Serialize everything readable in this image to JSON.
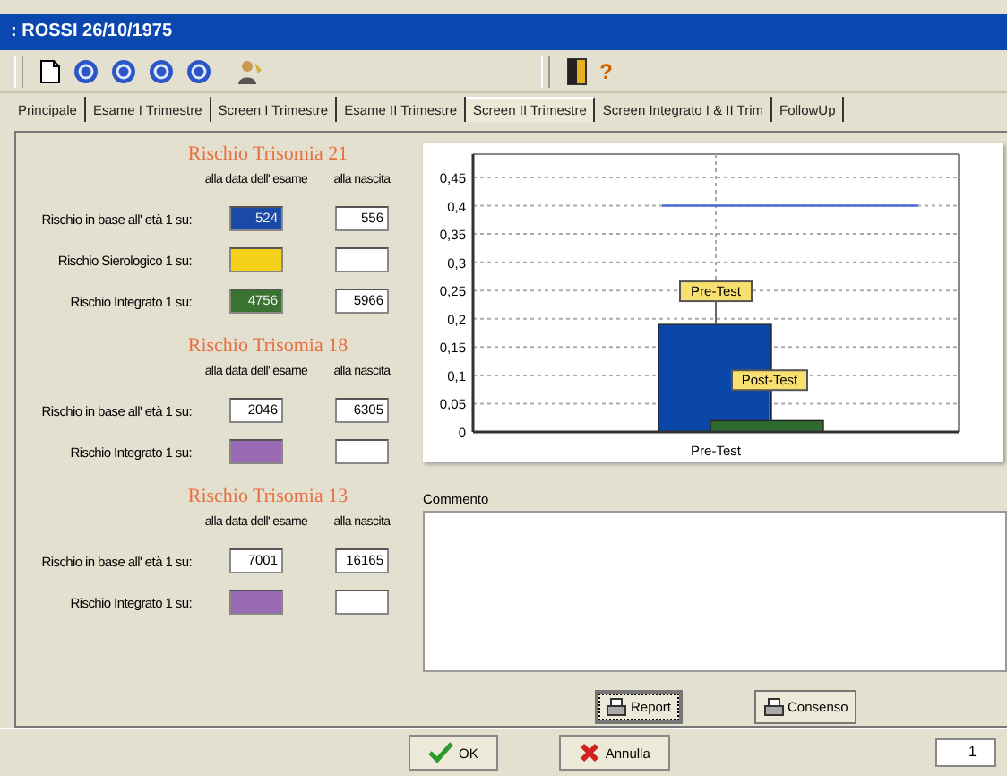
{
  "window": {
    "title": ": ROSSI 26/10/1975"
  },
  "toolbar": [
    {
      "kind": "document"
    },
    {
      "kind": "nav"
    },
    {
      "kind": "nav"
    },
    {
      "kind": "nav"
    },
    {
      "kind": "nav"
    },
    {
      "kind": "person"
    },
    {
      "kind": "door"
    },
    {
      "kind": "help",
      "label": "?"
    }
  ],
  "tabs": [
    {
      "label": "Principale",
      "selected": false
    },
    {
      "label": "Esame I Trimestre",
      "selected": false
    },
    {
      "label": "Screen I Trimestre",
      "selected": false
    },
    {
      "label": "Esame II Trimestre",
      "selected": false
    },
    {
      "label": "Screen II Trimestre",
      "selected": true
    },
    {
      "label": "Screen Integrato I & II Trim",
      "selected": false
    },
    {
      "label": "FollowUp",
      "selected": false
    }
  ],
  "sections": [
    {
      "title": "Rischio Trisomia  21",
      "col_1": "alla data dell' esame",
      "col_2": "alla nascita",
      "rows": [
        {
          "label": "Rischio in base all' età 1 su:",
          "exam": {
            "value": "524",
            "color": "#1a4aa8"
          },
          "birth": {
            "value": "556"
          }
        },
        {
          "label": "Rischio Sierologico 1 su:",
          "exam": {
            "color": "#f5d21a"
          },
          "birth": {}
        },
        {
          "label": "Rischio Integrato 1 su:",
          "exam": {
            "value": "4756",
            "color": "#3a7232"
          },
          "birth": {
            "value": "5966"
          }
        }
      ]
    },
    {
      "title": "Rischio Trisomia  18",
      "col_1": "alla data dell' esame",
      "col_2": "alla nascita",
      "rows": [
        {
          "label": "Rischio in base all' età 1 su:",
          "exam": {
            "value": "2046"
          },
          "birth": {
            "value": "6305"
          }
        },
        {
          "label": "Rischio Integrato 1 su:",
          "exam": {
            "color": "#9a6ab4"
          },
          "birth": {}
        }
      ]
    },
    {
      "title": "Rischio Trisomia  13",
      "col_1": "alla data dell' esame",
      "col_2": "alla nascita",
      "rows": [
        {
          "label": "Rischio in base all' età 1 su:",
          "exam": {
            "value": "7001"
          },
          "birth": {
            "value": "16165"
          }
        },
        {
          "label": "Rischio Integrato 1 su:",
          "exam": {
            "color": "#9a6ab4"
          },
          "birth": {}
        }
      ]
    }
  ],
  "chart": {
    "chart_data": {
      "type": "bar",
      "categories": [
        "Pre-Test"
      ],
      "series": [
        {
          "name": "Pre-Test",
          "color": "#0a47a8",
          "values": [
            0.19
          ]
        },
        {
          "name": "Post-Test",
          "color": "#2f6b2f",
          "values": [
            0.02
          ]
        }
      ],
      "ylim": [
        0,
        0.45
      ],
      "yticks": [
        {
          "value": 0,
          "label": "0"
        },
        {
          "value": 0.05,
          "label": "0,05"
        },
        {
          "value": 0.1,
          "label": "0,1"
        },
        {
          "value": 0.15,
          "label": "0,15"
        },
        {
          "value": 0.2,
          "label": "0,2"
        },
        {
          "value": 0.25,
          "label": "0,25"
        },
        {
          "value": 0.3,
          "label": "0,3"
        },
        {
          "value": 0.35,
          "label": "0,35"
        },
        {
          "value": 0.4,
          "label": "0,4"
        },
        {
          "value": 0.45,
          "label": "0,45"
        }
      ],
      "grid": true,
      "ref_lines": [
        {
          "axis": "y",
          "value": 0.4,
          "color": "#4a6ad0"
        }
      ]
    }
  },
  "comment": {
    "label": "Commento"
  },
  "buttons": [
    {
      "kind": "print",
      "label": "Report",
      "selected": true
    },
    {
      "kind": "print",
      "label": "Consenso",
      "selected": false
    }
  ],
  "footer": {
    "buttons": [
      {
        "kind": "ok",
        "label": "OK"
      },
      {
        "kind": "cancel",
        "label": "Annulla"
      }
    ],
    "page": "1"
  }
}
